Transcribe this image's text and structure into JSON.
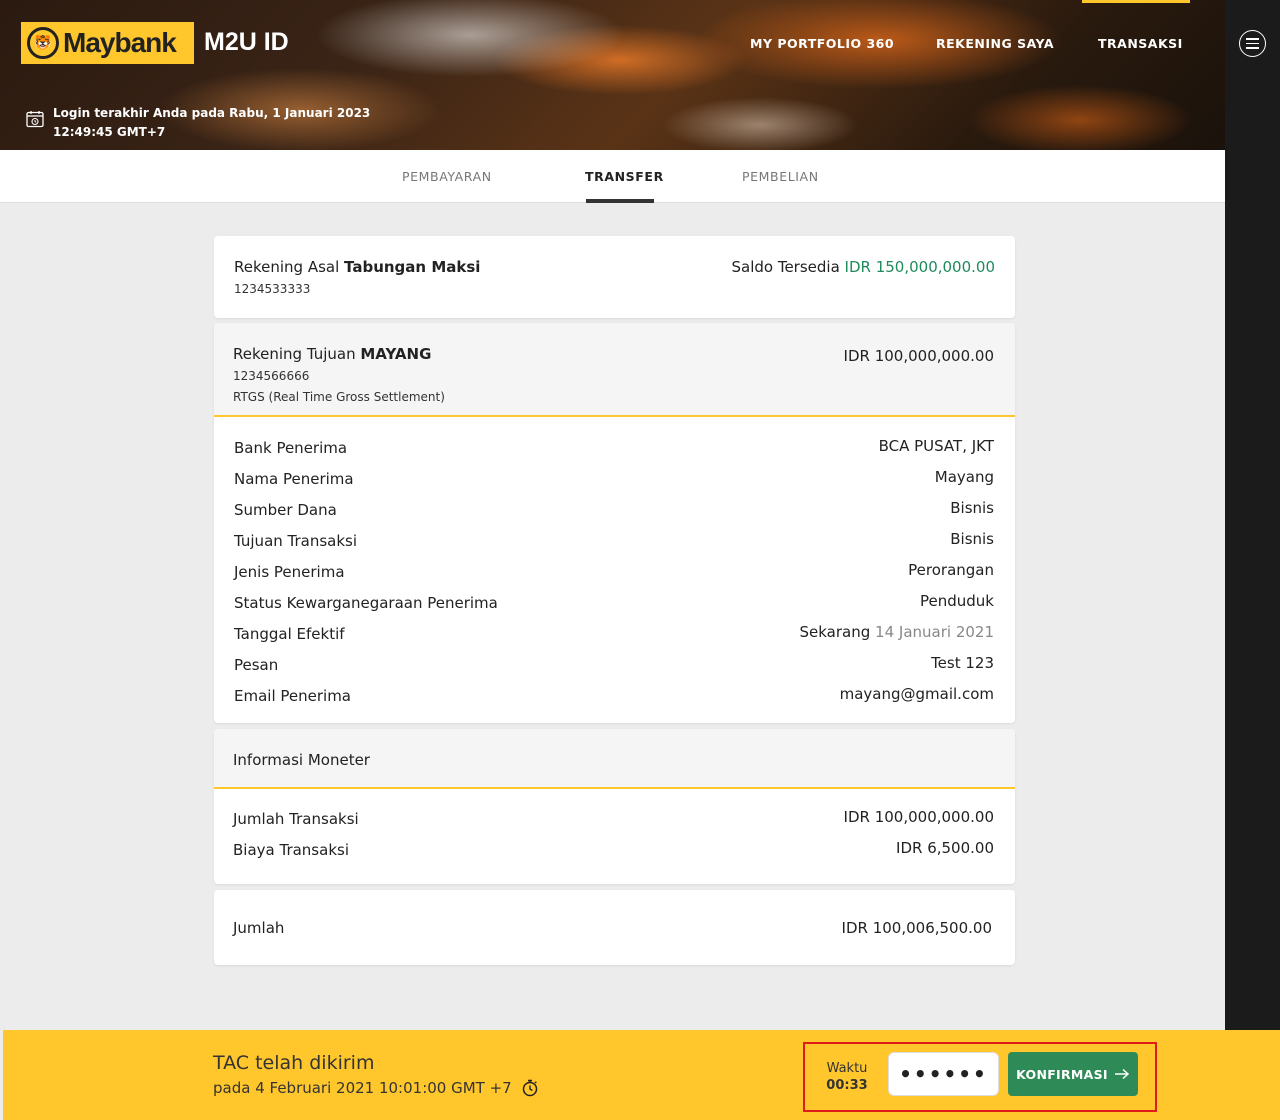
{
  "header": {
    "logo_text": "Maybank",
    "app_title": "M2U ID",
    "nav": [
      "MY PORTFOLIO 360",
      "REKENING SAYA",
      "TRANSAKSI"
    ],
    "active_nav": "TRANSAKSI",
    "last_login": "Login terakhir Anda pada Rabu, 1 Januari 2023 12:49:45 GMT+7"
  },
  "tabs": [
    "PEMBAYARAN",
    "TRANSFER",
    "PEMBELIAN"
  ],
  "active_tab": "TRANSFER",
  "source": {
    "label": "Rekening Asal",
    "account_name": "Tabungan Maksi",
    "account_number": "1234533333",
    "balance_label": "Saldo Tersedia",
    "balance": "IDR 150,000,000.00"
  },
  "destination": {
    "label": "Rekening Tujuan",
    "account_name": "MAYANG",
    "account_number": "1234566666",
    "method": "RTGS (Real Time Gross Settlement)",
    "amount": "IDR 100,000,000.00",
    "details": [
      {
        "label": "Bank Penerima",
        "value": "BCA PUSAT, JKT"
      },
      {
        "label": "Nama Penerima",
        "value": "Mayang"
      },
      {
        "label": "Sumber Dana",
        "value": "Bisnis"
      },
      {
        "label": "Tujuan Transaksi",
        "value": "Bisnis"
      },
      {
        "label": "Jenis Penerima",
        "value": "Perorangan"
      },
      {
        "label": "Status Kewarganegaraan Penerima",
        "value": "Penduduk"
      },
      {
        "label": "Tanggal Efektif",
        "value": "Sekarang",
        "value_extra": "14 Januari 2021"
      },
      {
        "label": "Pesan",
        "value": "Test 123"
      },
      {
        "label": "Email Penerima",
        "value": "mayang@gmail.com"
      }
    ]
  },
  "monetary": {
    "title": "Informasi Moneter",
    "rows": [
      {
        "label": "Jumlah Transaksi",
        "value": "IDR 100,000,000.00"
      },
      {
        "label": "Biaya Transaksi",
        "value": "IDR 6,500.00"
      }
    ]
  },
  "total": {
    "label": "Jumlah",
    "value": "IDR 100,006,500.00"
  },
  "tac": {
    "title": "TAC telah dikirim",
    "sent_at": "pada 4 Februari 2021 10:01:00 GMT +7",
    "timer_label": "Waktu",
    "timer_value": "00:33",
    "input_value": "••••••",
    "confirm_label": "KONFIRMASI"
  },
  "colors": {
    "brand_yellow": "#ffc72c",
    "balance_green": "#1f8a5c",
    "total_red": "#d23c3c",
    "confirm_green": "#2e8b57",
    "highlight_red": "#e01b1b"
  }
}
